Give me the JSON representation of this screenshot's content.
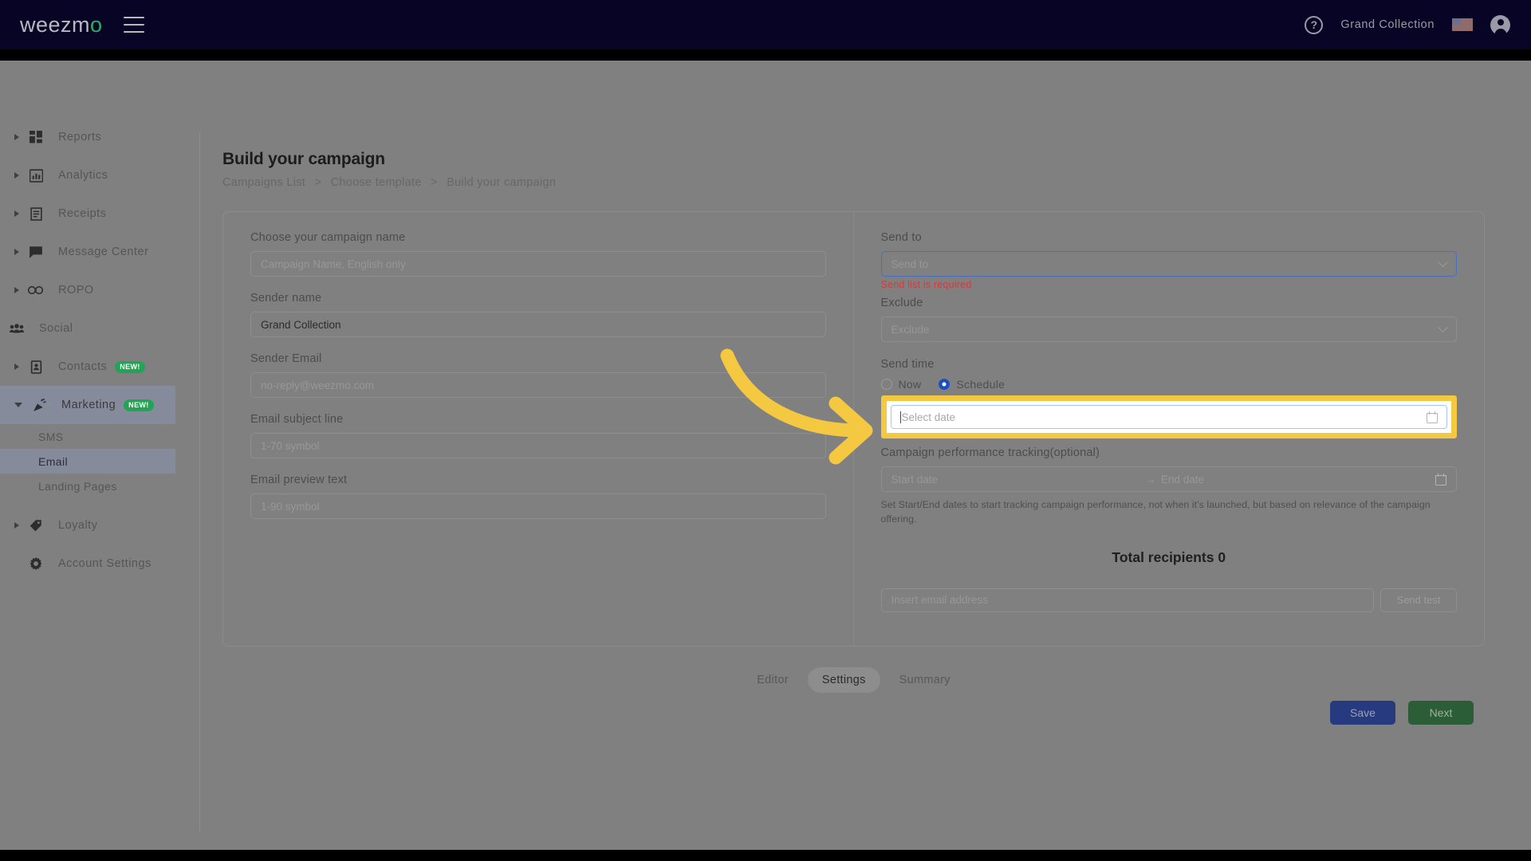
{
  "topbar": {
    "logo_text": "weezm",
    "logo_accent": "o",
    "menu_icon": "hamburger-icon",
    "help_icon": "?",
    "account_name": "Grand Collection",
    "flag_icon": "us-flag-icon",
    "avatar_icon": "user-avatar-icon"
  },
  "sidebar": {
    "items": [
      {
        "label": "Reports",
        "icon": "grid-icon",
        "expandable": true,
        "badge": ""
      },
      {
        "label": "Analytics",
        "icon": "bar-chart-icon",
        "expandable": true,
        "badge": ""
      },
      {
        "label": "Receipts",
        "icon": "receipt-icon",
        "expandable": true,
        "badge": ""
      },
      {
        "label": "Message Center",
        "icon": "chat-bubble-icon",
        "expandable": true,
        "badge": ""
      },
      {
        "label": "ROPO",
        "icon": "infinity-icon",
        "expandable": true,
        "badge": ""
      },
      {
        "label": "Social",
        "icon": "people-icon",
        "expandable": true,
        "badge": ""
      },
      {
        "label": "Contacts",
        "icon": "contact-card-icon",
        "expandable": true,
        "badge": "NEW!"
      },
      {
        "label": "Marketing",
        "icon": "megaphone-icon",
        "expandable": true,
        "badge": "NEW!",
        "expanded": true
      },
      {
        "label": "Loyalty",
        "icon": "tag-icon",
        "expandable": true,
        "badge": ""
      },
      {
        "label": "Account Settings",
        "icon": "gear-icon",
        "expandable": false,
        "badge": ""
      }
    ],
    "marketing_subitems": [
      {
        "label": "SMS",
        "selected": false
      },
      {
        "label": "Email",
        "selected": true
      },
      {
        "label": "Landing Pages",
        "selected": false
      }
    ]
  },
  "page": {
    "title": "Build your campaign",
    "breadcrumb": [
      "Campaigns List",
      "Choose template",
      "Build your campaign"
    ],
    "breadcrumb_sep": ">"
  },
  "form_left": {
    "campaign_name": {
      "label": "Choose your campaign name",
      "placeholder": "Campaign Name, English only",
      "value": ""
    },
    "sender_name": {
      "label": "Sender name",
      "placeholder": "",
      "value": "Grand Collection"
    },
    "sender_email": {
      "label": "Sender Email",
      "placeholder": "no-reply@weezmo.com",
      "value": ""
    },
    "subject_line": {
      "label": "Email subject line",
      "placeholder": "1-70 symbol",
      "value": ""
    },
    "preview_text": {
      "label": "Email preview text",
      "placeholder": "1-90 symbol",
      "value": ""
    }
  },
  "form_right": {
    "send_to": {
      "label": "Send to",
      "placeholder": "Send to",
      "value": "",
      "error": "Send list is required"
    },
    "exclude": {
      "label": "Exclude",
      "placeholder": "Exclude",
      "value": ""
    },
    "send_time": {
      "label": "Send time",
      "options": [
        {
          "label": "Now",
          "selected": false
        },
        {
          "label": "Schedule",
          "selected": true
        }
      ]
    },
    "schedule_date": {
      "placeholder": "Select date",
      "value": "",
      "calendar_icon": "calendar-icon",
      "highlighted": true
    },
    "tracking": {
      "label": "Campaign performance tracking(optional)",
      "start_placeholder": "Start date",
      "end_placeholder": "End date",
      "range_arrow": "→",
      "calendar_icon": "calendar-icon",
      "helper": "Set Start/End dates to start tracking campaign performance, not when it's launched, but based on relevance of the campaign offering."
    },
    "total_recipients": "Total recipients 0",
    "test_email": {
      "placeholder": "Insert email address",
      "value": ""
    },
    "send_test_label": "Send test"
  },
  "tabs": [
    {
      "label": "Editor",
      "active": false
    },
    {
      "label": "Settings",
      "active": true
    },
    {
      "label": "Summary",
      "active": false
    }
  ],
  "actions": {
    "save_label": "Save",
    "next_label": "Next"
  },
  "annotation": {
    "arrow_color": "#f5c842",
    "highlight_color": "#f5c842"
  }
}
